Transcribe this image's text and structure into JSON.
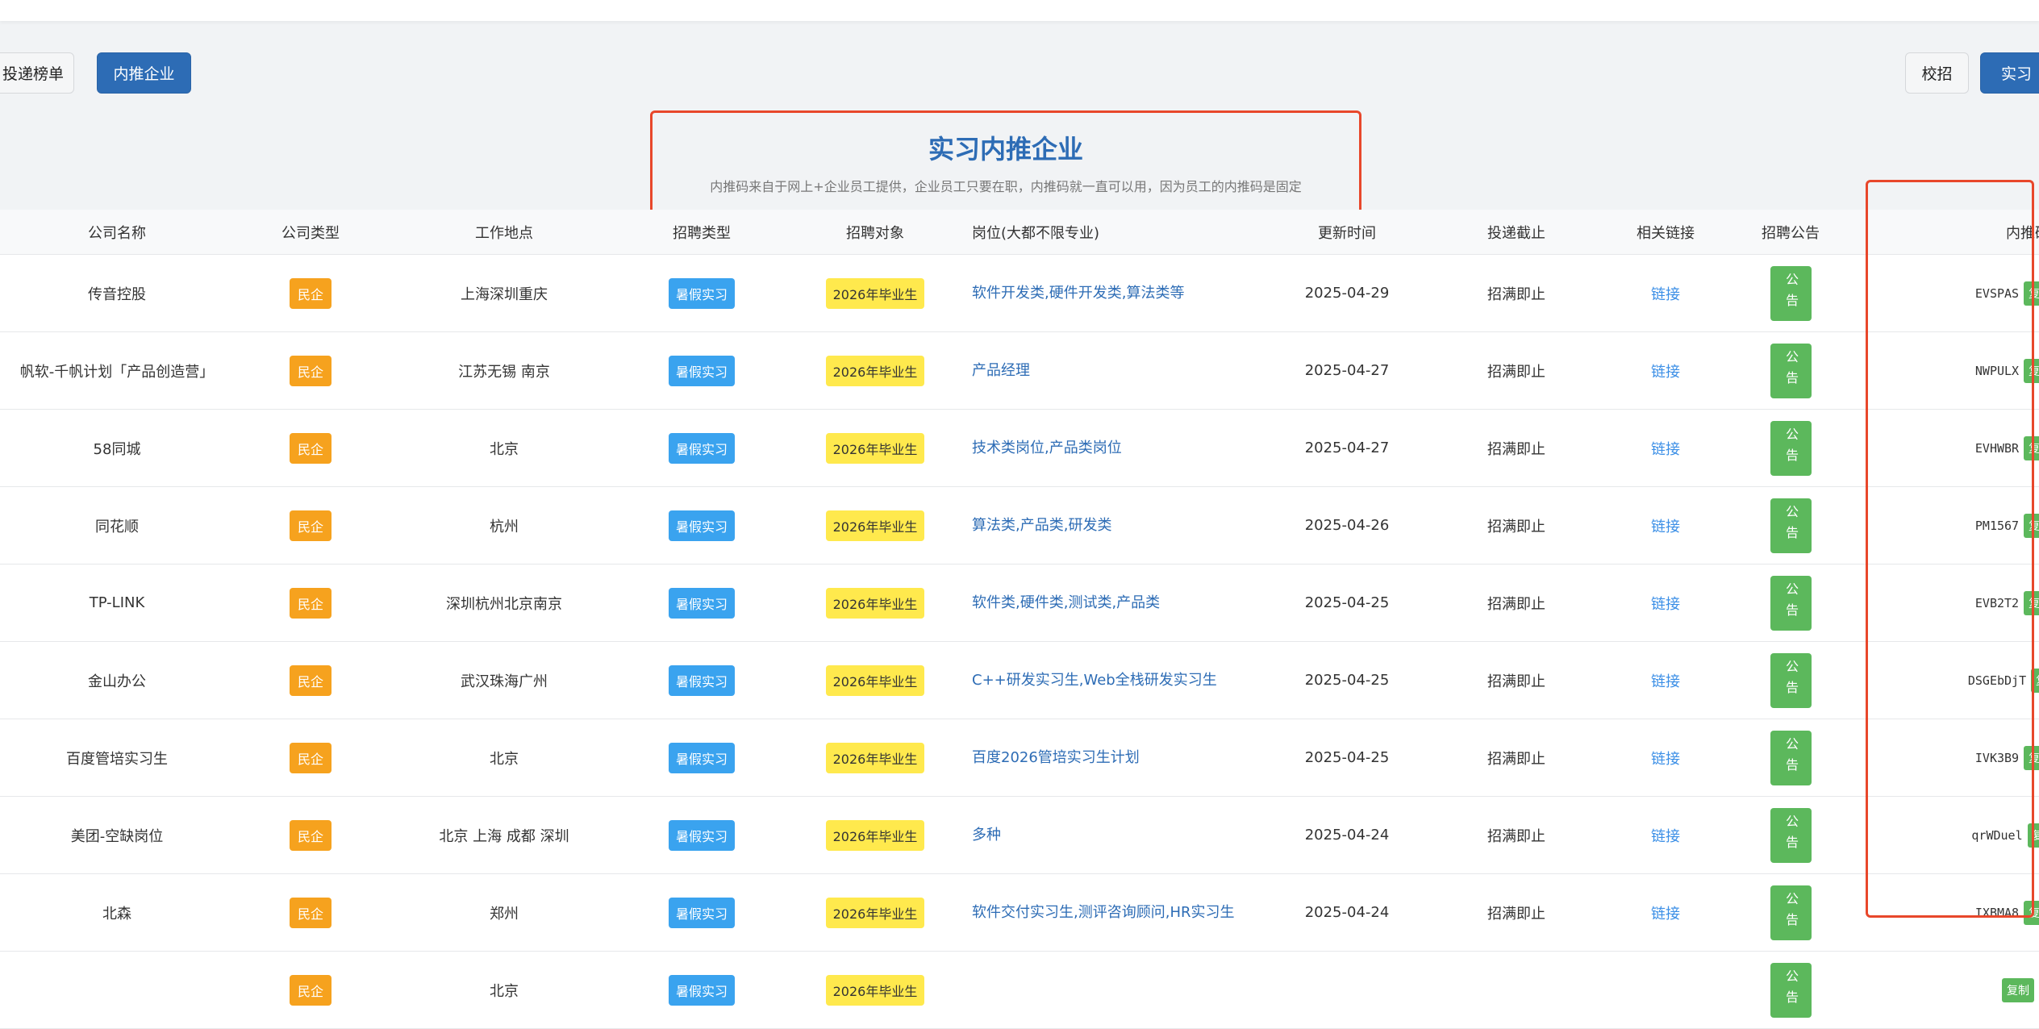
{
  "nav": {
    "left_buttons": [
      "投递榜单",
      "内推企业"
    ],
    "right_buttons": [
      "校招",
      "实习"
    ]
  },
  "header": {
    "title": "实习内推企业",
    "subtitle": "内推码来自于网上+企业员工提供，企业员工只要在职，内推码就一直可以用，因为员工的内推码是固定"
  },
  "table": {
    "columns": [
      "公司名称",
      "公司类型",
      "工作地点",
      "招聘类型",
      "招聘对象",
      "岗位(大都不限专业)",
      "更新时间",
      "投递截止",
      "相关链接",
      "招聘公告",
      "内推码"
    ],
    "rows": [
      {
        "company": "传音控股",
        "type": "民企",
        "location": "上海深圳重庆",
        "recruit": "暑假实习",
        "target": "2026年毕业生",
        "position": "软件开发类,硬件开发类,算法类等",
        "updated": "2025-04-29",
        "deadline": "招满即止",
        "link": "链接",
        "notice": "公告",
        "code": "EVSPAS",
        "copy": "复制"
      },
      {
        "company": "帆软-千帆计划「产品创造营」",
        "type": "民企",
        "location": "江苏无锡 南京",
        "recruit": "暑假实习",
        "target": "2026年毕业生",
        "position": "产品经理",
        "updated": "2025-04-27",
        "deadline": "招满即止",
        "link": "链接",
        "notice": "公告",
        "code": "NWPULX",
        "copy": "复制"
      },
      {
        "company": "58同城",
        "type": "民企",
        "location": "北京",
        "recruit": "暑假实习",
        "target": "2026年毕业生",
        "position": "技术类岗位,产品类岗位",
        "updated": "2025-04-27",
        "deadline": "招满即止",
        "link": "链接",
        "notice": "公告",
        "code": "EVHWBR",
        "copy": "复制"
      },
      {
        "company": "同花顺",
        "type": "民企",
        "location": "杭州",
        "recruit": "暑假实习",
        "target": "2026年毕业生",
        "position": "算法类,产品类,研发类",
        "updated": "2025-04-26",
        "deadline": "招满即止",
        "link": "链接",
        "notice": "公告",
        "code": "PM1567",
        "copy": "复制"
      },
      {
        "company": "TP-LINK",
        "type": "民企",
        "location": "深圳杭州北京南京",
        "recruit": "暑假实习",
        "target": "2026年毕业生",
        "position": "软件类,硬件类,测试类,产品类",
        "updated": "2025-04-25",
        "deadline": "招满即止",
        "link": "链接",
        "notice": "公告",
        "code": "EVB2T2",
        "copy": "复制"
      },
      {
        "company": "金山办公",
        "type": "民企",
        "location": "武汉珠海广州",
        "recruit": "暑假实习",
        "target": "2026年毕业生",
        "position": "C++研发实习生,Web全栈研发实习生",
        "updated": "2025-04-25",
        "deadline": "招满即止",
        "link": "链接",
        "notice": "公告",
        "code": "DSGEbDjT",
        "copy": "复制"
      },
      {
        "company": "百度管培实习生",
        "type": "民企",
        "location": "北京",
        "recruit": "暑假实习",
        "target": "2026年毕业生",
        "position": "百度2026管培实习生计划",
        "updated": "2025-04-25",
        "deadline": "招满即止",
        "link": "链接",
        "notice": "公告",
        "code": "IVK3B9",
        "copy": "复制"
      },
      {
        "company": "美团-空缺岗位",
        "type": "民企",
        "location": "北京 上海 成都 深圳",
        "recruit": "暑假实习",
        "target": "2026年毕业生",
        "position": "多种",
        "updated": "2025-04-24",
        "deadline": "招满即止",
        "link": "链接",
        "notice": "公告",
        "code": "qrWDuel",
        "copy": "复制"
      },
      {
        "company": "北森",
        "type": "民企",
        "location": "郑州",
        "recruit": "暑假实习",
        "target": "2026年毕业生",
        "position": "软件交付实习生,测评咨询顾问,HR实习生",
        "updated": "2025-04-24",
        "deadline": "招满即止",
        "link": "链接",
        "notice": "公告",
        "code": "IXBMA8",
        "copy": "复制"
      },
      {
        "company": "",
        "type": "民企",
        "location": "北京",
        "recruit": "暑假实习",
        "target": "2026年毕业生",
        "position": "",
        "updated": "",
        "deadline": "",
        "link": "",
        "notice": "公告",
        "code": "",
        "copy": "复制"
      }
    ]
  },
  "colors": {
    "primary": "#2d6cb5",
    "accent_red": "#e8472b",
    "orange": "#f6a21e",
    "blue_badge": "#3aa3ef",
    "yellow_badge": "#ffe94d",
    "green": "#5cb85c"
  }
}
